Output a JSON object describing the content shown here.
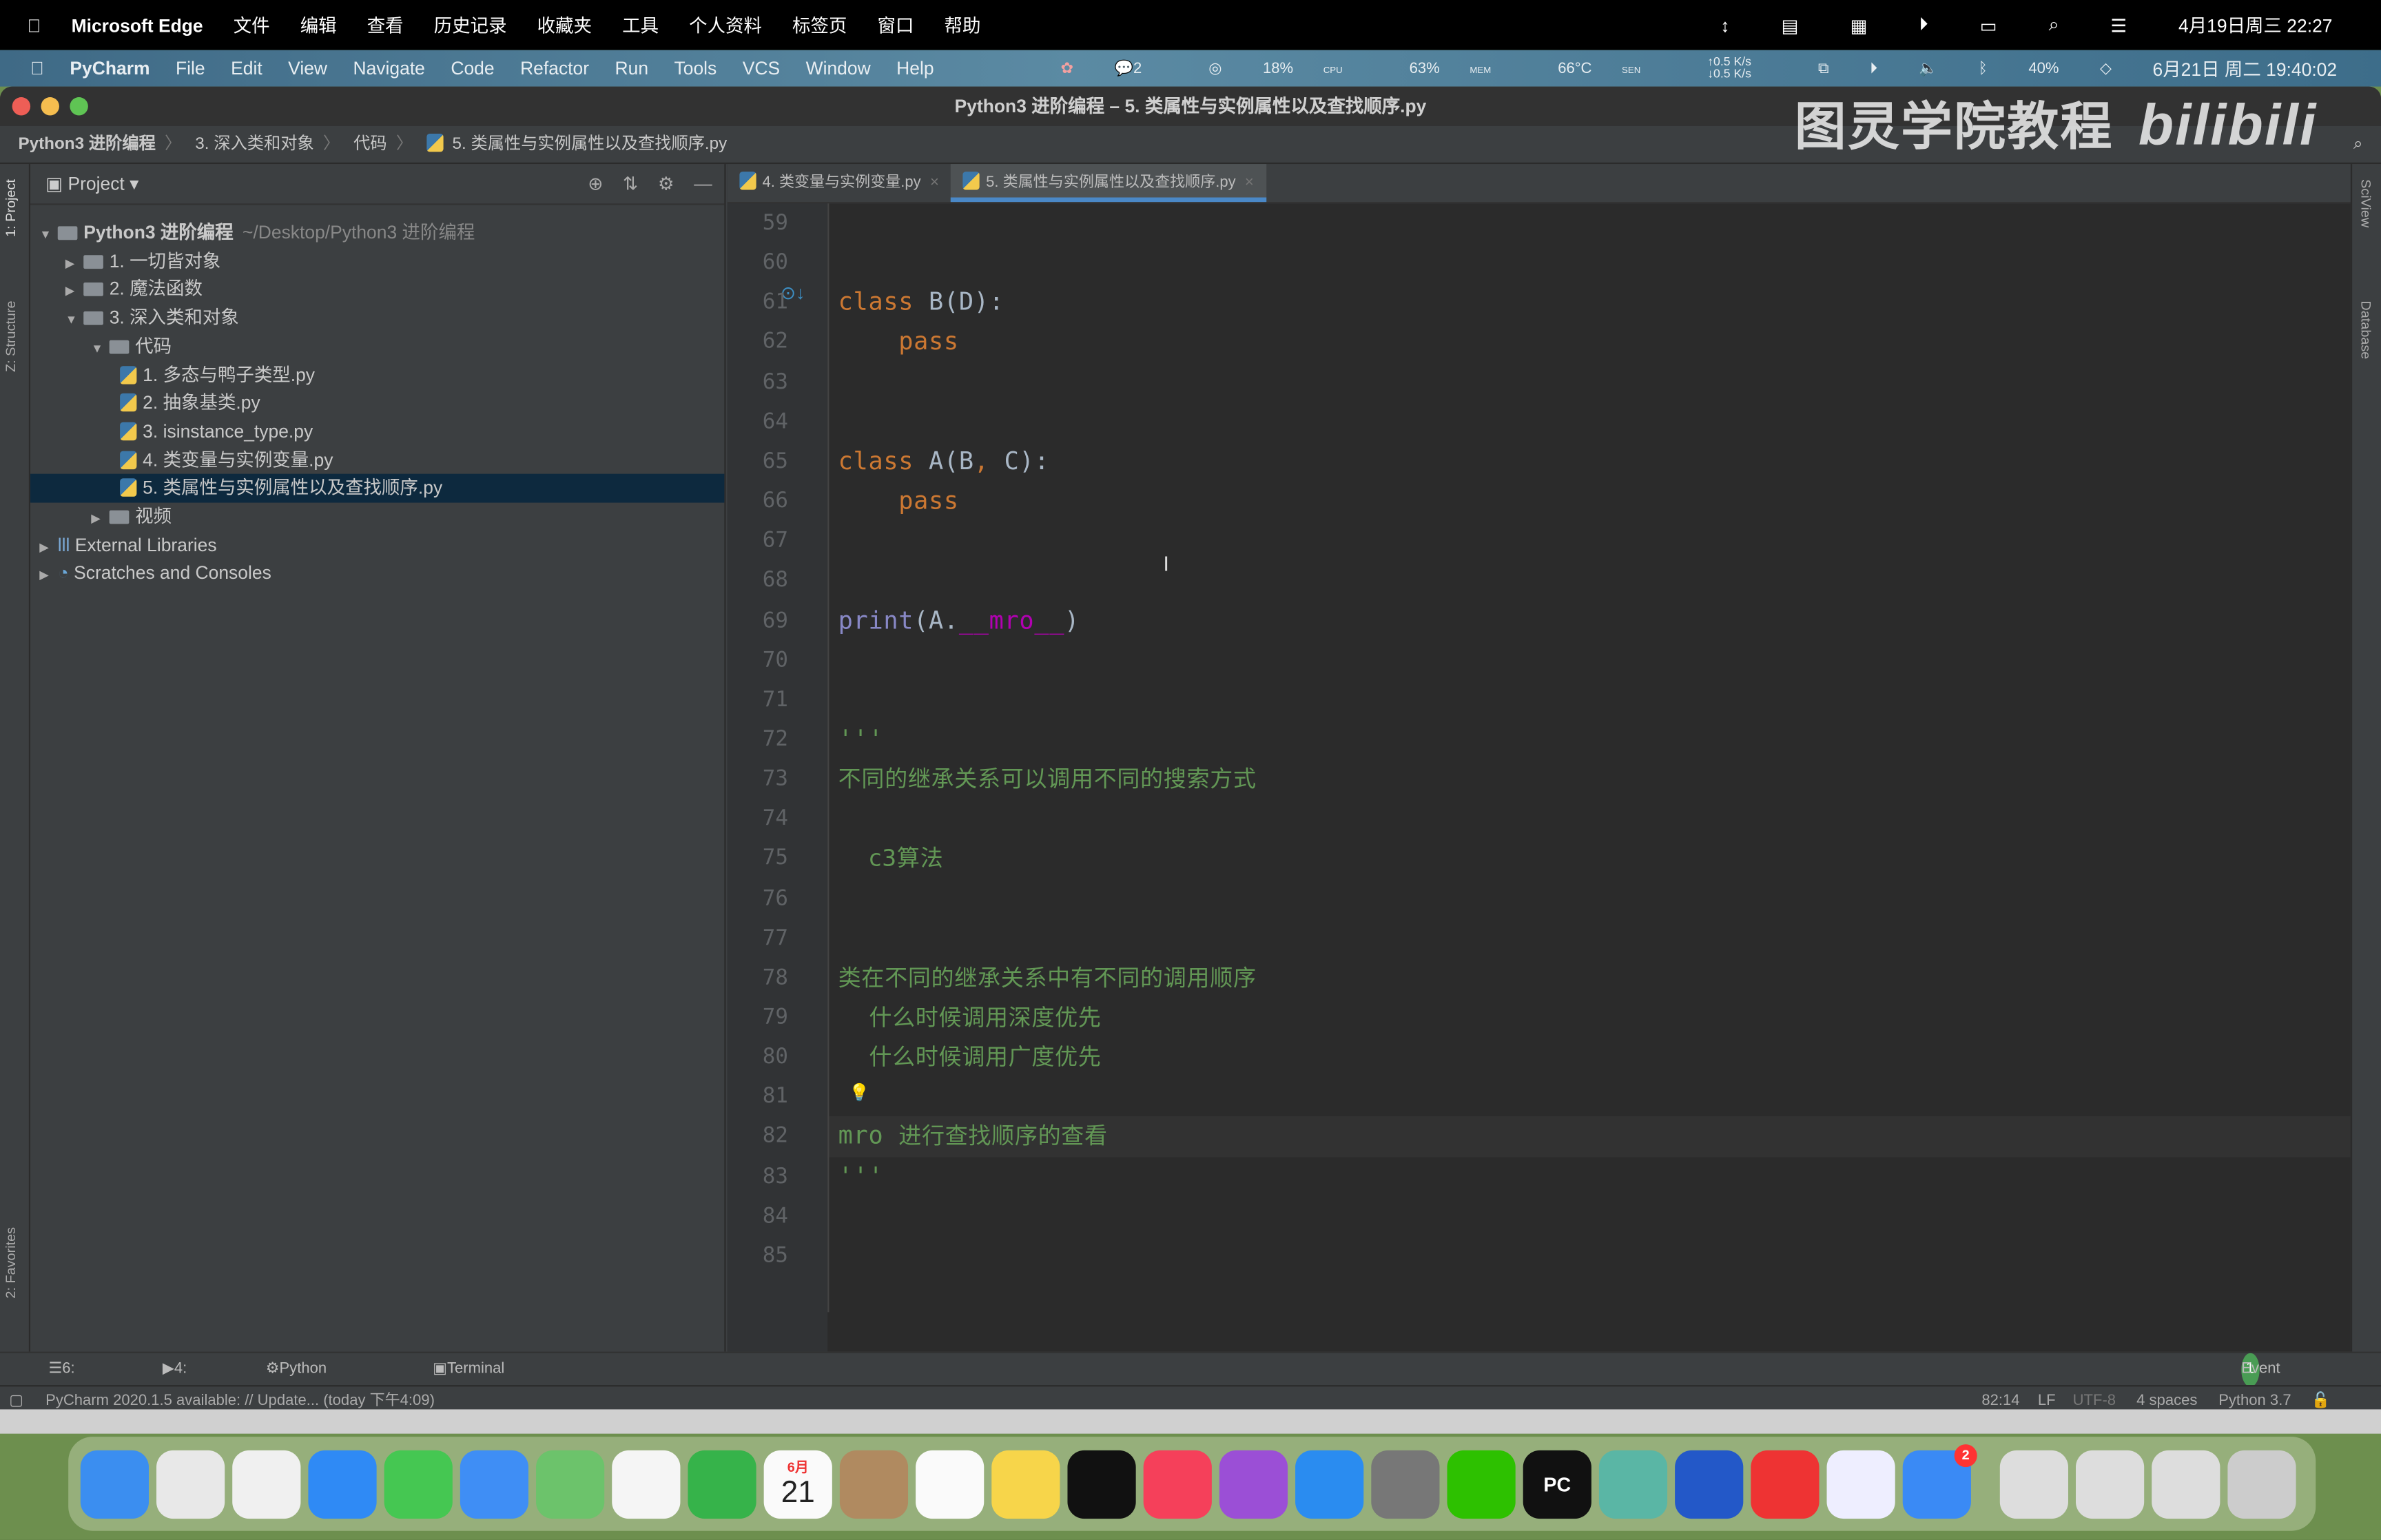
{
  "mac_menubar": {
    "app": "Microsoft Edge",
    "items": [
      "文件",
      "编辑",
      "查看",
      "历史记录",
      "收藏夹",
      "工具",
      "个人资料",
      "标签页",
      "窗口",
      "帮助"
    ],
    "datetime": "4月19日周三 22:27"
  },
  "pycharm_menubar": {
    "app": "PyCharm",
    "items": [
      "File",
      "Edit",
      "View",
      "Navigate",
      "Code",
      "Refactor",
      "Run",
      "Tools",
      "VCS",
      "Window",
      "Help"
    ],
    "chat_count": "2",
    "cpu": "18%",
    "cpu_label": "CPU",
    "mem": "63%",
    "mem_label": "MEM",
    "temp": "66°C",
    "temp_label": "SEN",
    "net_up": "0.5 K/s",
    "net_down": "0.5 K/s",
    "battery": "40%",
    "datetime": "6月21日 周二 19:40:02"
  },
  "window": {
    "title": "Python3 进阶编程 – 5. 类属性与实例属性以及查找顺序.py"
  },
  "breadcrumb": [
    "Python3 进阶编程",
    "3. 深入类和对象",
    "代码",
    "5. 类属性与实例属性以及查找顺序.py"
  ],
  "watermark": "图灵学院教程",
  "watermark_logo": "bilibili",
  "left_strip": {
    "project": "1: Project",
    "structure": "Z: Structure",
    "favorites": "2: Favorites"
  },
  "right_strip": {
    "sciview": "SciView",
    "database": "Database"
  },
  "project_panel": {
    "title": "Project",
    "tree": [
      {
        "label": "Python3 进阶编程",
        "suffix": "~/Desktop/Python3 进阶编程",
        "type": "folder",
        "depth": 0,
        "expanded": true,
        "bold": true
      },
      {
        "label": "1. 一切皆对象",
        "type": "folder",
        "depth": 1,
        "expanded": false
      },
      {
        "label": "2. 魔法函数",
        "type": "folder",
        "depth": 1,
        "expanded": false
      },
      {
        "label": "3. 深入类和对象",
        "type": "folder",
        "depth": 1,
        "expanded": true
      },
      {
        "label": "代码",
        "type": "folder",
        "depth": 2,
        "expanded": true
      },
      {
        "label": "1. 多态与鸭子类型.py",
        "type": "py",
        "depth": 3
      },
      {
        "label": "2. 抽象基类.py",
        "type": "py",
        "depth": 3
      },
      {
        "label": "3. isinstance_type.py",
        "type": "py",
        "depth": 3
      },
      {
        "label": "4. 类变量与实例变量.py",
        "type": "py",
        "depth": 3
      },
      {
        "label": "5. 类属性与实例属性以及查找顺序.py",
        "type": "py",
        "depth": 3,
        "selected": true
      },
      {
        "label": "视频",
        "type": "folder",
        "depth": 2,
        "expanded": false
      },
      {
        "label": "External Libraries",
        "type": "lib",
        "depth": 0,
        "expanded": false
      },
      {
        "label": "Scratches and Consoles",
        "type": "scratch",
        "depth": 0,
        "expanded": false
      }
    ]
  },
  "editor": {
    "tabs": [
      {
        "label": "4. 类变量与实例变量.py",
        "active": false
      },
      {
        "label": "5. 类属性与实例属性以及查找顺序.py",
        "active": true
      }
    ],
    "current_line": 82,
    "lines": [
      {
        "n": "59",
        "tokens": []
      },
      {
        "n": "60",
        "tokens": []
      },
      {
        "n": "61",
        "tokens": [
          {
            "t": "class ",
            "c": "k"
          },
          {
            "t": "B(D):",
            "c": "p"
          }
        ]
      },
      {
        "n": "62",
        "tokens": [
          {
            "t": "    pass",
            "c": "k"
          }
        ]
      },
      {
        "n": "63",
        "tokens": []
      },
      {
        "n": "64",
        "tokens": []
      },
      {
        "n": "65",
        "tokens": [
          {
            "t": "class ",
            "c": "k"
          },
          {
            "t": "A(B",
            "c": "p"
          },
          {
            "t": ", ",
            "c": "k"
          },
          {
            "t": "C):",
            "c": "p"
          }
        ]
      },
      {
        "n": "66",
        "tokens": [
          {
            "t": "    pass",
            "c": "k"
          }
        ]
      },
      {
        "n": "67",
        "tokens": []
      },
      {
        "n": "68",
        "tokens": []
      },
      {
        "n": "69",
        "tokens": [
          {
            "t": "print",
            "c": "b"
          },
          {
            "t": "(A.",
            "c": "p"
          },
          {
            "t": "__mro__",
            "c": "m"
          },
          {
            "t": ")",
            "c": "p"
          }
        ]
      },
      {
        "n": "70",
        "tokens": []
      },
      {
        "n": "71",
        "tokens": []
      },
      {
        "n": "72",
        "tokens": [
          {
            "t": "'''",
            "c": "d"
          }
        ]
      },
      {
        "n": "73",
        "tokens": [
          {
            "t": "不同的继承关系可以调用不同的搜索方式",
            "c": "d cjk"
          }
        ]
      },
      {
        "n": "74",
        "tokens": []
      },
      {
        "n": "75",
        "tokens": [
          {
            "t": "    c3算法",
            "c": "d cjk"
          }
        ]
      },
      {
        "n": "76",
        "tokens": []
      },
      {
        "n": "77",
        "tokens": []
      },
      {
        "n": "78",
        "tokens": [
          {
            "t": "类在不同的继承关系中有不同的调用顺序",
            "c": "d cjk"
          }
        ]
      },
      {
        "n": "79",
        "tokens": [
          {
            "t": "    什么时候调用深度优先",
            "c": "d cjk"
          }
        ]
      },
      {
        "n": "80",
        "tokens": [
          {
            "t": "    什么时候调用广度优先",
            "c": "d cjk"
          }
        ]
      },
      {
        "n": "81",
        "tokens": []
      },
      {
        "n": "82",
        "tokens": [
          {
            "t": "mro ",
            "c": "d"
          },
          {
            "t": "进行查找顺序的查看",
            "c": "d cjk"
          }
        ]
      },
      {
        "n": "83",
        "tokens": [
          {
            "t": "'''",
            "c": "d"
          }
        ]
      },
      {
        "n": "84",
        "tokens": []
      },
      {
        "n": "85",
        "tokens": []
      }
    ]
  },
  "tool_windows": {
    "todo": "6: TODO",
    "run": "4: Run",
    "console": "Python Console",
    "terminal": "Terminal",
    "event_log": "Event Log",
    "event_count": "1"
  },
  "status_bar": {
    "message": "PyCharm 2020.1.5 available: // Update... (today 下午4:09)",
    "position": "82:14",
    "line_sep": "LF",
    "encoding": "UTF-8",
    "indent": "4 spaces",
    "interpreter": "Python 3.7"
  },
  "dock": {
    "calendar_month": "6月",
    "calendar_day": "21",
    "messages_badge": "2",
    "apps": [
      "finder",
      "launchpad",
      "chrome",
      "safari",
      "messages",
      "mail",
      "maps",
      "photos",
      "facetime",
      "calendar",
      "contacts",
      "reminders",
      "notes",
      "apple-tv",
      "music",
      "podcasts",
      "app-store",
      "system-preferences",
      "wechat",
      "pycharm",
      "atom",
      "infuse",
      "xmind",
      "mindnode",
      "feedback",
      "documents",
      "documents",
      "documents",
      "trash"
    ]
  },
  "colors": {
    "keyword": "#cc7832",
    "builtin": "#8888c6",
    "magic": "#b200b2",
    "docstring": "#629755",
    "editor_bg": "#2b2b2b",
    "accent": "#4a88c7"
  }
}
